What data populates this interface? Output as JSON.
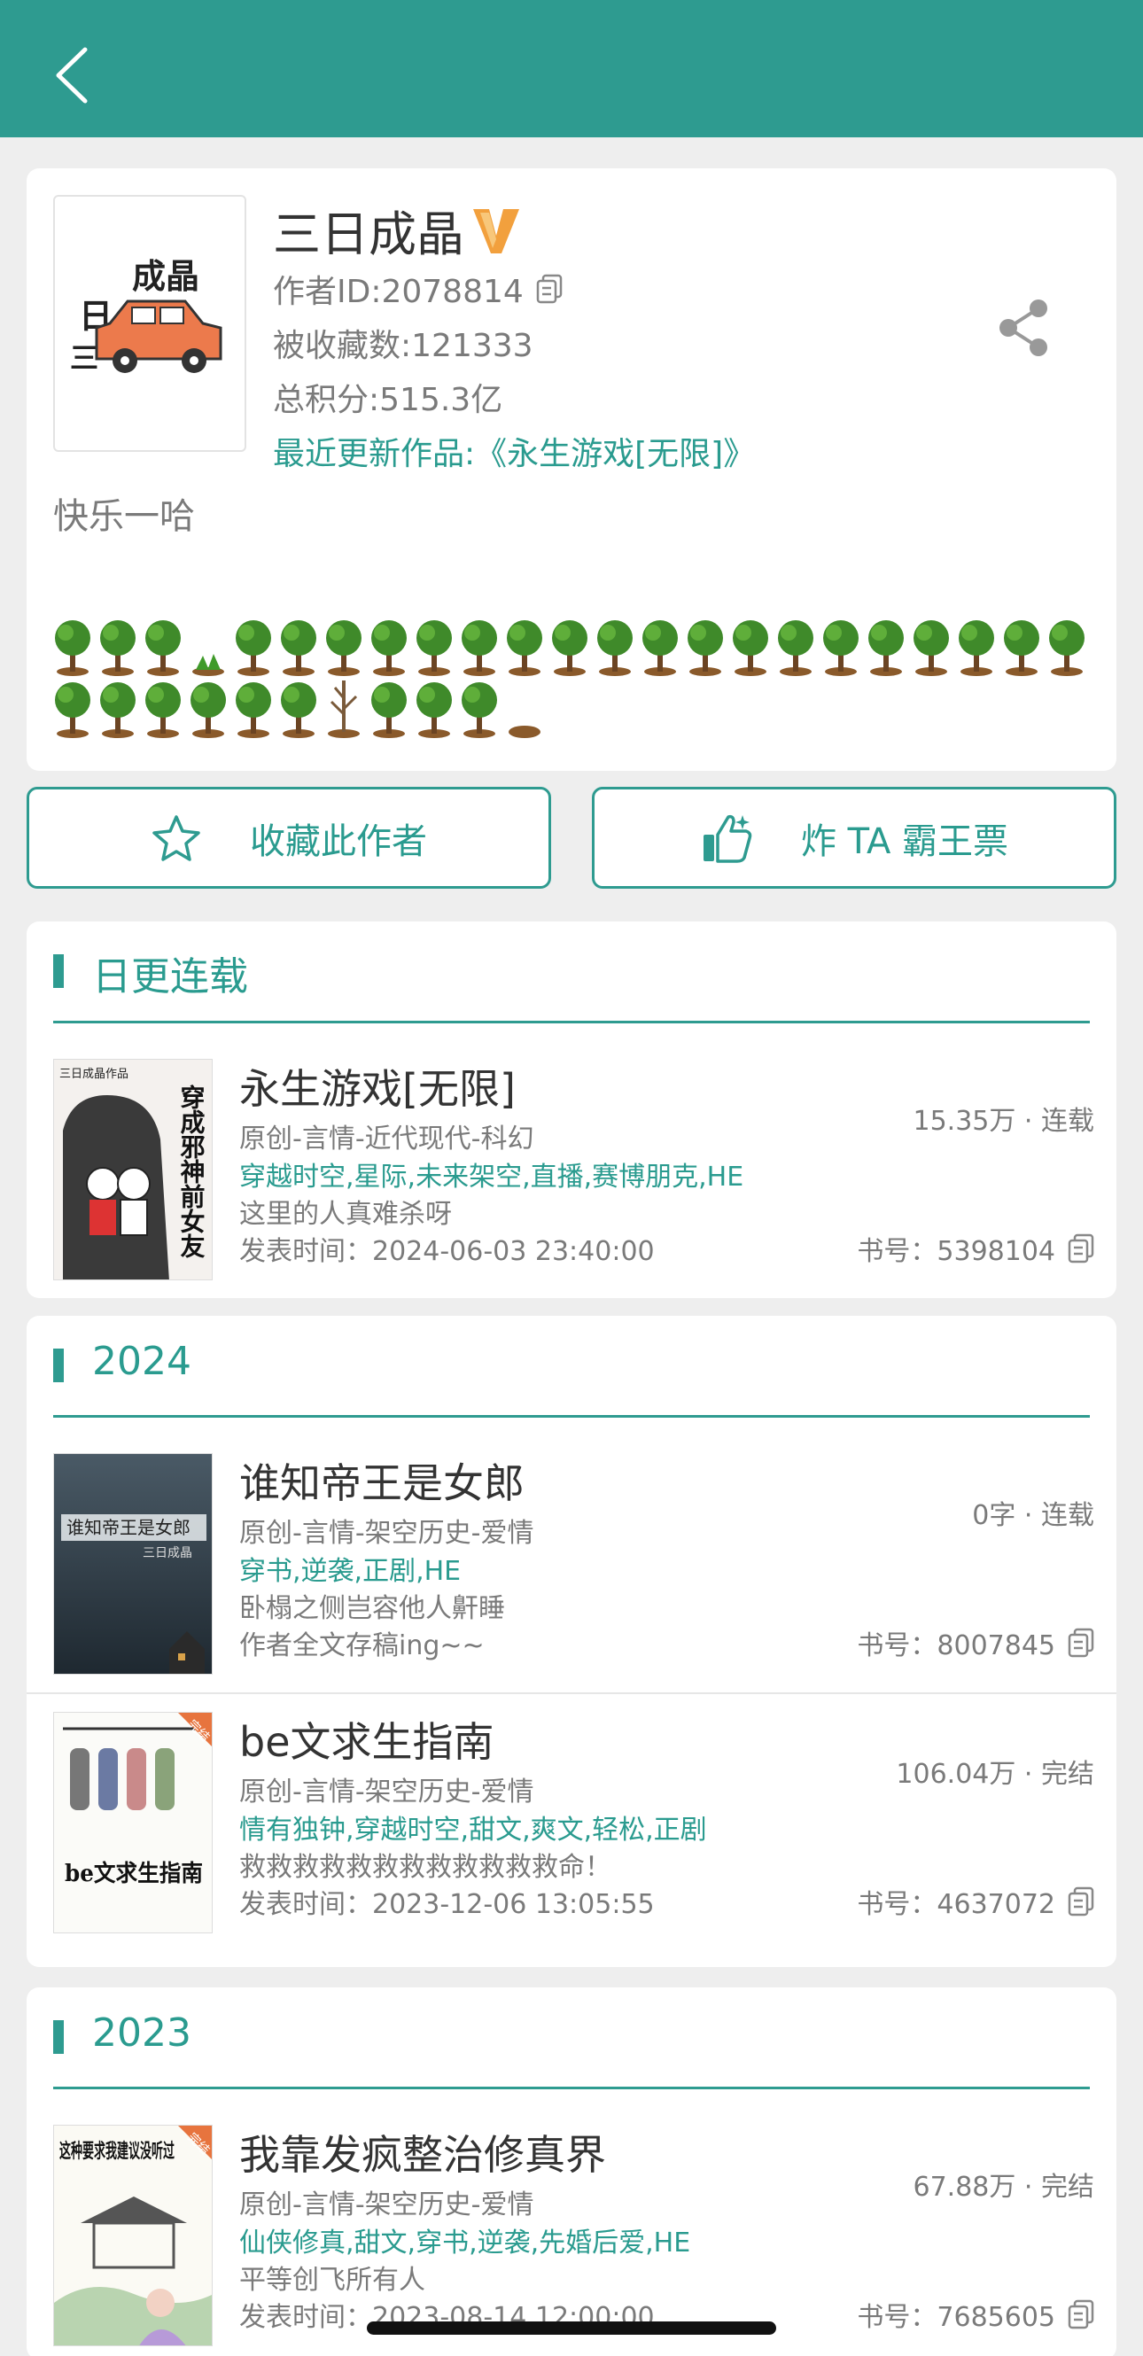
{
  "header": {
    "back_icon": "chevron-left-icon",
    "background": "#2e9b90"
  },
  "author": {
    "name": "三日成晶",
    "id_text": "作者ID:2078814",
    "favorites_text": "被收藏数:121333",
    "score_text": "总积分:515.3亿",
    "latest_text": "最近更新作品:《永生游戏[无限]》",
    "bio": "快乐一哈",
    "avatar_text_top": "成晶",
    "avatar_text_left": "日",
    "avatar_text_side": "三",
    "vip_icon": "vip-v-icon"
  },
  "trees": {
    "row1": [
      "tree",
      "tree",
      "tree",
      "sprout",
      "tree",
      "tree",
      "tree",
      "tree",
      "tree",
      "tree",
      "tree",
      "tree",
      "tree",
      "tree",
      "tree",
      "tree",
      "tree",
      "tree",
      "tree",
      "tree",
      "tree",
      "tree",
      "tree"
    ],
    "row2": [
      "tree",
      "tree",
      "tree",
      "tree",
      "tree",
      "tree",
      "dead-tree",
      "tree",
      "tree",
      "tree",
      "stump"
    ]
  },
  "actions": {
    "favorite_label": "收藏此作者",
    "vote_label": "炸 TA 霸王票"
  },
  "sections": [
    {
      "title": "日更连载",
      "books": [
        {
          "title": "永生游戏[无限]",
          "genre": "原创-言情-近代现代-科幻",
          "tags": "穿越时空,星际,未来架空,直播,赛博朋克,HE",
          "line3": "这里的人真难杀呀",
          "line4": "发表时间：2024-06-03 23:40:00",
          "stat": "15.35万 · 连载",
          "book_no": "书号：5398104",
          "cover": {
            "header": "三日成晶作品",
            "title": "穿成邪神前女友",
            "tone": "dark"
          }
        }
      ]
    },
    {
      "title": "2024",
      "books": [
        {
          "title": "谁知帝王是女郎",
          "genre": "原创-言情-架空历史-爱情",
          "tags": "穿书,逆袭,正剧,HE",
          "line3": "卧榻之侧岂容他人鼾睡",
          "line4": "作者全文存稿ing~~",
          "stat": "0字 · 连载",
          "book_no": "书号：8007845",
          "cover": {
            "header": "谁知帝王是女郎",
            "title": "三日成晶",
            "tone": "night"
          }
        },
        {
          "title": "be文求生指南",
          "genre": "原创-言情-架空历史-爱情",
          "tags": "情有独钟,穿越时空,甜文,爽文,轻松,正剧",
          "line3": "救救救救救救救救救救救救命！",
          "line4": "发表时间：2023-12-06 13:05:55",
          "stat": "106.04万 · 完结",
          "book_no": "书号：4637072",
          "cover": {
            "header": "完结",
            "title": "be文求生指南",
            "tone": "light"
          }
        }
      ]
    },
    {
      "title": "2023",
      "books": [
        {
          "title": "我靠发疯整治修真界",
          "genre": "原创-言情-架空历史-爱情",
          "tags": "仙侠修真,甜文,穿书,逆袭,先婚后爱,HE",
          "line3": "平等创飞所有人",
          "line4": "发表时间：2023-08-14 12:00:00",
          "stat": "67.88万 · 完结",
          "book_no": "书号：7685605",
          "cover": {
            "header": "完结",
            "title": "这种要求我建议没听过",
            "tone": "ink"
          }
        }
      ]
    }
  ],
  "colors": {
    "accent": "#2e9b90",
    "accent_text": "#2a9b8f",
    "vip": "#f2a03d"
  }
}
